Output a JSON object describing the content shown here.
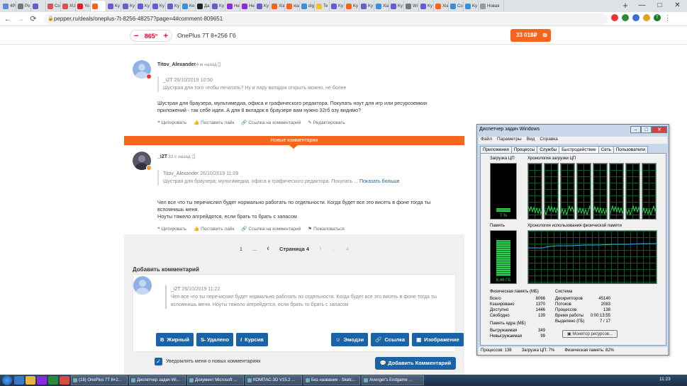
{
  "browser": {
    "tabs": [
      {
        "label": "4Pl",
        "color": "#5c8ad8"
      },
      {
        "label": "Ро",
        "color": "#777777"
      },
      {
        "label": "",
        "color": "#6a5acd"
      },
      {
        "label": "Co",
        "color": "#d9534f"
      },
      {
        "label": "XU",
        "color": "#d9534f"
      },
      {
        "label": "Yo",
        "color": "#e02020"
      },
      {
        "label": "",
        "color": "#f7641b"
      },
      {
        "label": "Ky",
        "color": "#6a5acd"
      },
      {
        "label": "Ky",
        "color": "#6a5acd"
      },
      {
        "label": "Ky",
        "color": "#6a5acd"
      },
      {
        "label": "Ky",
        "color": "#6a5acd"
      },
      {
        "label": "Ky",
        "color": "#6a5acd"
      },
      {
        "label": "Ke",
        "color": "#3a8fd9"
      },
      {
        "label": "Да",
        "color": "#222222"
      },
      {
        "label": "Ky",
        "color": "#6a5acd"
      },
      {
        "label": "He",
        "color": "#8a2be2"
      },
      {
        "label": "He",
        "color": "#8a2be2"
      },
      {
        "label": "Ky",
        "color": "#6a5acd"
      },
      {
        "label": "Xia",
        "color": "#f7641b"
      },
      {
        "label": "xia",
        "color": "#f7641b"
      },
      {
        "label": "dig",
        "color": "#3a8fd9"
      },
      {
        "label": "Te",
        "color": "#f2c12e"
      },
      {
        "label": "Ky",
        "color": "#6a5acd"
      },
      {
        "label": "Ky",
        "color": "#f7641b"
      },
      {
        "label": "Ky",
        "color": "#6a5acd"
      },
      {
        "label": "Xia",
        "color": "#3a8fd9"
      },
      {
        "label": "Ky",
        "color": "#6a5acd"
      },
      {
        "label": "Wi",
        "color": "#777777"
      },
      {
        "label": "Ky",
        "color": "#6a5acd"
      },
      {
        "label": "Xia",
        "color": "#f7641b"
      },
      {
        "label": "Co",
        "color": "#3a8fd9"
      },
      {
        "label": "Ky",
        "color": "#3a8fd9"
      },
      {
        "label": "Новая",
        "color": "#999999"
      }
    ],
    "url": "pepper.ru/deals/oneplus-7t-8256-48257?page=4#comment-809651",
    "new_tab": "+",
    "window_controls": [
      "—",
      "□",
      "✕"
    ],
    "profile_initial": "T"
  },
  "site_header": {
    "temperature": "865°",
    "minus": "−",
    "plus": "+",
    "deal_title": "OnePlus 7T 8+256 Гб",
    "price_button": "33 018₽"
  },
  "comments": [
    {
      "user": "Titov_Alexander",
      "time": "14 м назад",
      "quote_user": "_i2T",
      "quote_time": "26/10/2019 10:50",
      "quote_text": "Шустрая для того чтобы печатать? Ну и пару вкладок открыть можно, не более",
      "text": "Шустрая для браузера, мультимедиа, офиса и графического редактора. Покупать ноут для игр или ресурсоемких приложений - так себе идея. А для 8 вкладок в браузере вам нужно 32гб озу видимо?",
      "actions": [
        "Цитировать",
        "Поставить лайк",
        "Ссылка на комментарий",
        "Редактировать"
      ]
    },
    {
      "user": "_i2T",
      "time": "33 с назад",
      "quote_user": "Titov_Alexander",
      "quote_time": "26/10/2019 11:09",
      "quote_text": "Шустрая для браузера, мультимедиа, офиса и графического редактора. Покупать ...",
      "show_more": "Показать больше",
      "text": "Чел все что ты перечислил будет нормально работать по отдельности. Когда будет все это висеть в фоне тогда ты вспомнишь меня.",
      "text2": "Ноуты тяжело апгрейдятся, если брать то брать с запасом",
      "actions": [
        "Цитировать",
        "Поставить лайк",
        "Ссылка на комментарий",
        "Пожаловаться"
      ]
    }
  ],
  "new_comments_label": "Новые комментарии",
  "pagination": {
    "first": "1",
    "dots": "...",
    "current": "Страница 4",
    "last_dots": "...",
    "last": "4"
  },
  "add_comment": {
    "heading": "Добавить комментарий",
    "draft_user": "_i2T",
    "draft_time": "26/10/2019 11:22",
    "draft_quote": "Чел все что ты перечислил будет нормально работать по отдельности. Когда будет все это висеть в фоне тогда ты вспомнишь меня. Ноуты тяжело апгрейдятся, если брать то брать с запасом",
    "buttons_left": [
      "Жирный",
      "Удалено",
      "Курсив"
    ],
    "buttons_right": [
      "Эмодзи",
      "Ссылка",
      "Изображение"
    ],
    "notify": "Уведомлять меня о новых комментариях",
    "submit": "Добавить Комментарий"
  },
  "task_manager": {
    "title": "Диспетчер задач Windows",
    "menu": [
      "Файл",
      "Параметры",
      "Вид",
      "Справка"
    ],
    "tabs": [
      "Приложения",
      "Процессы",
      "Службы",
      "Быстродействие",
      "Сеть",
      "Пользователи"
    ],
    "cpu_label": "Загрузка ЦП",
    "cpu_history_label": "Хронология загрузки ЦП",
    "cpu_value": "7 %",
    "cpu_percent": 7,
    "mem_label": "Память",
    "mem_history_label": "Хронология использования физической памяти",
    "mem_value": "6,46 ГБ",
    "mem_percent": 82,
    "phys_mem_title": "Физическая память (МБ)",
    "phys_mem": [
      [
        "Всего",
        "8066"
      ],
      [
        "Кэшировано",
        "1370"
      ],
      [
        "Доступно",
        "1446"
      ],
      [
        "Свободно",
        "139"
      ]
    ],
    "kernel_title": "Память ядра (МБ)",
    "kernel": [
      [
        "Выгружаемая",
        "349"
      ],
      [
        "Невыгружаемая",
        "99"
      ]
    ],
    "system_title": "Система",
    "system": [
      [
        "Дескрипторов",
        "45140"
      ],
      [
        "Потоков",
        "2083"
      ],
      [
        "Процессов",
        "138"
      ],
      [
        "Время работы",
        "0:00:13:55"
      ],
      [
        "Выделено (ГБ)",
        "7 / 17"
      ]
    ],
    "resource_button": "Монитор ресурсов...",
    "status": [
      "Процессов: 138",
      "Загрузка ЦП: 7%",
      "Физическая память: 82%"
    ]
  },
  "taskbar": {
    "apps": [
      "(18) OnePlus 7T 8+2...",
      "Диспетчер задач Wi...",
      "Документ Microsoft ...",
      "КОМПАС-3D V15.2 ...",
      "Без названия - Sketc...",
      "Avenger's Endgame ..."
    ],
    "clock": "11:23"
  }
}
